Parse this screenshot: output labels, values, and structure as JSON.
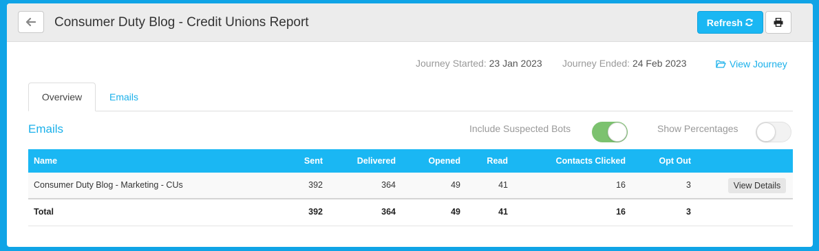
{
  "header": {
    "title": "Consumer Duty Blog - Credit Unions Report",
    "refresh_label": "Refresh",
    "back_icon": "arrow-left-icon",
    "refresh_icon": "refresh-icon",
    "print_icon": "print-icon"
  },
  "journey": {
    "started_label": "Journey Started:",
    "started_value": "23 Jan 2023",
    "ended_label": "Journey Ended:",
    "ended_value": "24 Feb 2023",
    "view_label": "View Journey",
    "view_icon": "folder-open-icon"
  },
  "tabs": [
    {
      "label": "Overview",
      "active": true
    },
    {
      "label": "Emails",
      "active": false
    }
  ],
  "section": {
    "title": "Emails",
    "toggles": [
      {
        "label": "Include Suspected Bots",
        "on": true
      },
      {
        "label": "Show Percentages",
        "on": false
      }
    ]
  },
  "table": {
    "columns": [
      "Name",
      "Sent",
      "Delivered",
      "Opened",
      "Read",
      "Contacts Clicked",
      "Opt Out"
    ],
    "rows": [
      {
        "name": "Consumer Duty Blog - Marketing - CUs",
        "sent": "392",
        "delivered": "364",
        "opened": "49",
        "read": "41",
        "clicked": "16",
        "opt_out": "3",
        "action_label": "View Details"
      }
    ],
    "total": {
      "name": "Total",
      "sent": "392",
      "delivered": "364",
      "opened": "49",
      "read": "41",
      "clicked": "16",
      "opt_out": "3"
    }
  },
  "colors": {
    "accent": "#1ab7f3",
    "toggle_on": "#7cc26f",
    "background": "#10a4e6"
  }
}
